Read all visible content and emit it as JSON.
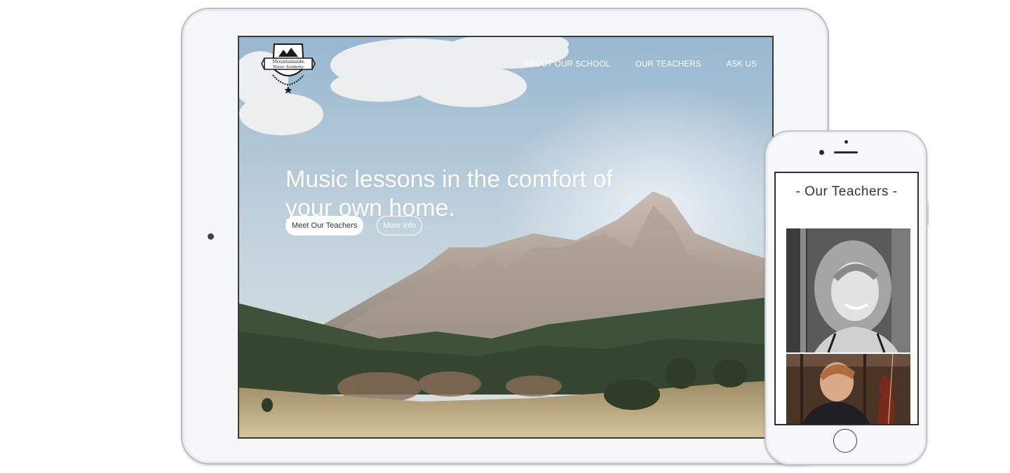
{
  "site": {
    "logo": {
      "line1": "Mountainside",
      "line2": "Music Academy"
    },
    "nav": [
      {
        "label": "ABOUT OUR SCHOOL"
      },
      {
        "label": "OUR TEACHERS"
      },
      {
        "label": "ASK US"
      }
    ],
    "hero": {
      "title": "Music lessons in the comfort of your own home.",
      "primary_button": "Meet Our Teachers",
      "secondary_button": "More Info"
    }
  },
  "mobile": {
    "heading": "- Our Teachers -"
  },
  "colors": {
    "white": "#ffffff",
    "device_frame": "#f6f7f9",
    "screen_border": "#3a3a3a"
  }
}
